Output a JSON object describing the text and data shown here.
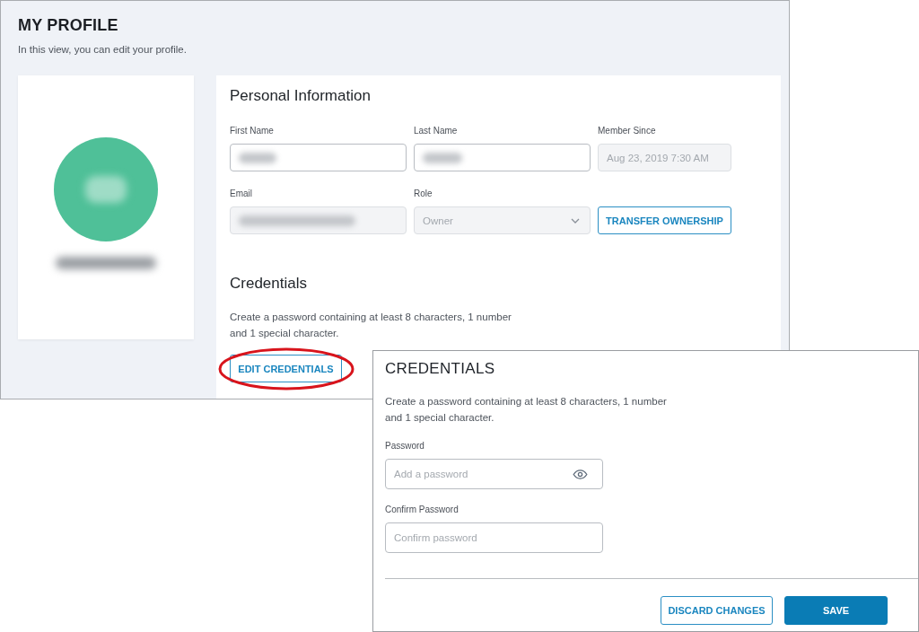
{
  "profile_page": {
    "title": "MY PROFILE",
    "subtitle": "In this view, you can edit your profile.",
    "profile_card": {
      "initials_redacted": true,
      "name_redacted": true
    },
    "personal_information": {
      "heading": "Personal Information",
      "fields": [
        {
          "kind": "text",
          "label": "First Name",
          "disabled": false,
          "redacted": true
        },
        {
          "kind": "text",
          "label": "Last Name",
          "disabled": false,
          "redacted": true
        },
        {
          "kind": "text",
          "label": "Member Since",
          "disabled": true,
          "value": "Aug 23, 2019 7:30 AM"
        },
        {
          "kind": "text",
          "label": "Email",
          "disabled": true,
          "redacted": true
        },
        {
          "kind": "select",
          "label": "Role",
          "disabled": true,
          "value": "Owner"
        },
        {
          "kind": "button",
          "text": "TRANSFER OWNERSHIP"
        }
      ]
    },
    "credentials": {
      "heading": "Credentials",
      "description": "Create a password containing at least 8 characters, 1 number and 1 special character.",
      "button": {
        "label": "EDIT CREDENTIALS",
        "highlighted": true
      }
    }
  },
  "credentials_dialog": {
    "title": "CREDENTIALS",
    "description": "Create a password containing at least 8 characters, 1 number and 1 special character.",
    "fields": [
      {
        "label": "Password",
        "placeholder": "Add a password",
        "reveal_toggle": true
      },
      {
        "label": "Confirm Password",
        "placeholder": "Confirm password",
        "reveal_toggle": false
      }
    ],
    "buttons": [
      {
        "kind": "secondary",
        "label": "DISCARD CHANGES"
      },
      {
        "kind": "primary",
        "label": "SAVE"
      }
    ]
  }
}
